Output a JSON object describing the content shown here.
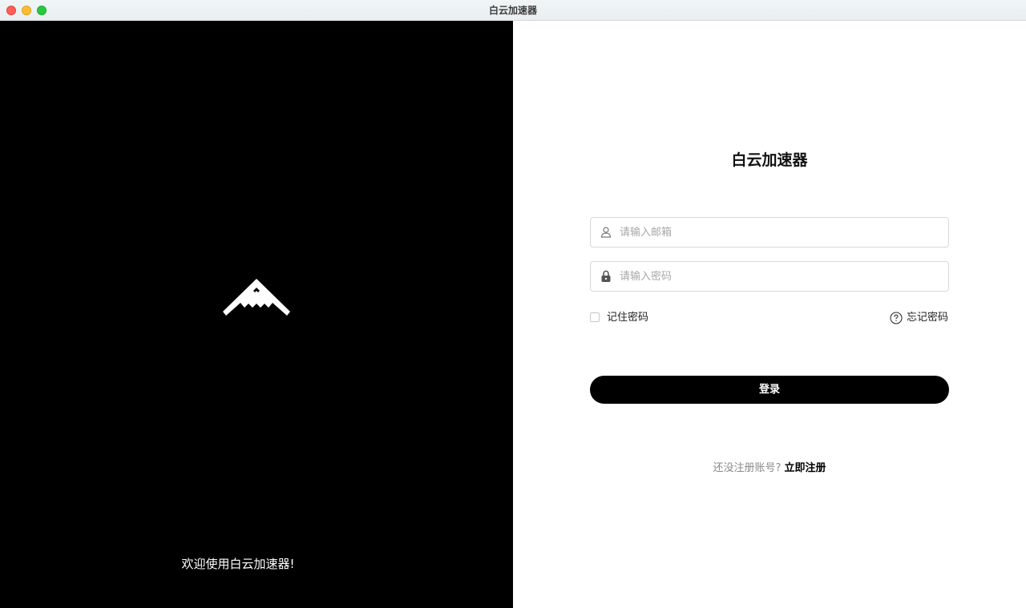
{
  "window": {
    "title": "白云加速器"
  },
  "left_panel": {
    "logo_icon": "stealth-bomber-icon",
    "welcome": "欢迎使用白云加速器!"
  },
  "login_form": {
    "heading": "白云加速器",
    "email": {
      "icon": "user-icon",
      "placeholder": "请输入邮箱",
      "value": ""
    },
    "password": {
      "icon": "lock-icon",
      "placeholder": "请输入密码",
      "value": ""
    },
    "remember_label": "记住密码",
    "remember_checked": false,
    "forgot_icon": "question-circle-icon",
    "forgot_label": "忘记密码",
    "submit_label": "登录",
    "register_prompt": "还没注册账号?",
    "register_link": "立即注册"
  },
  "colors": {
    "left_background": "#000000",
    "button_background": "#000000",
    "text_primary": "#111111",
    "text_muted": "#8a8a8a"
  }
}
